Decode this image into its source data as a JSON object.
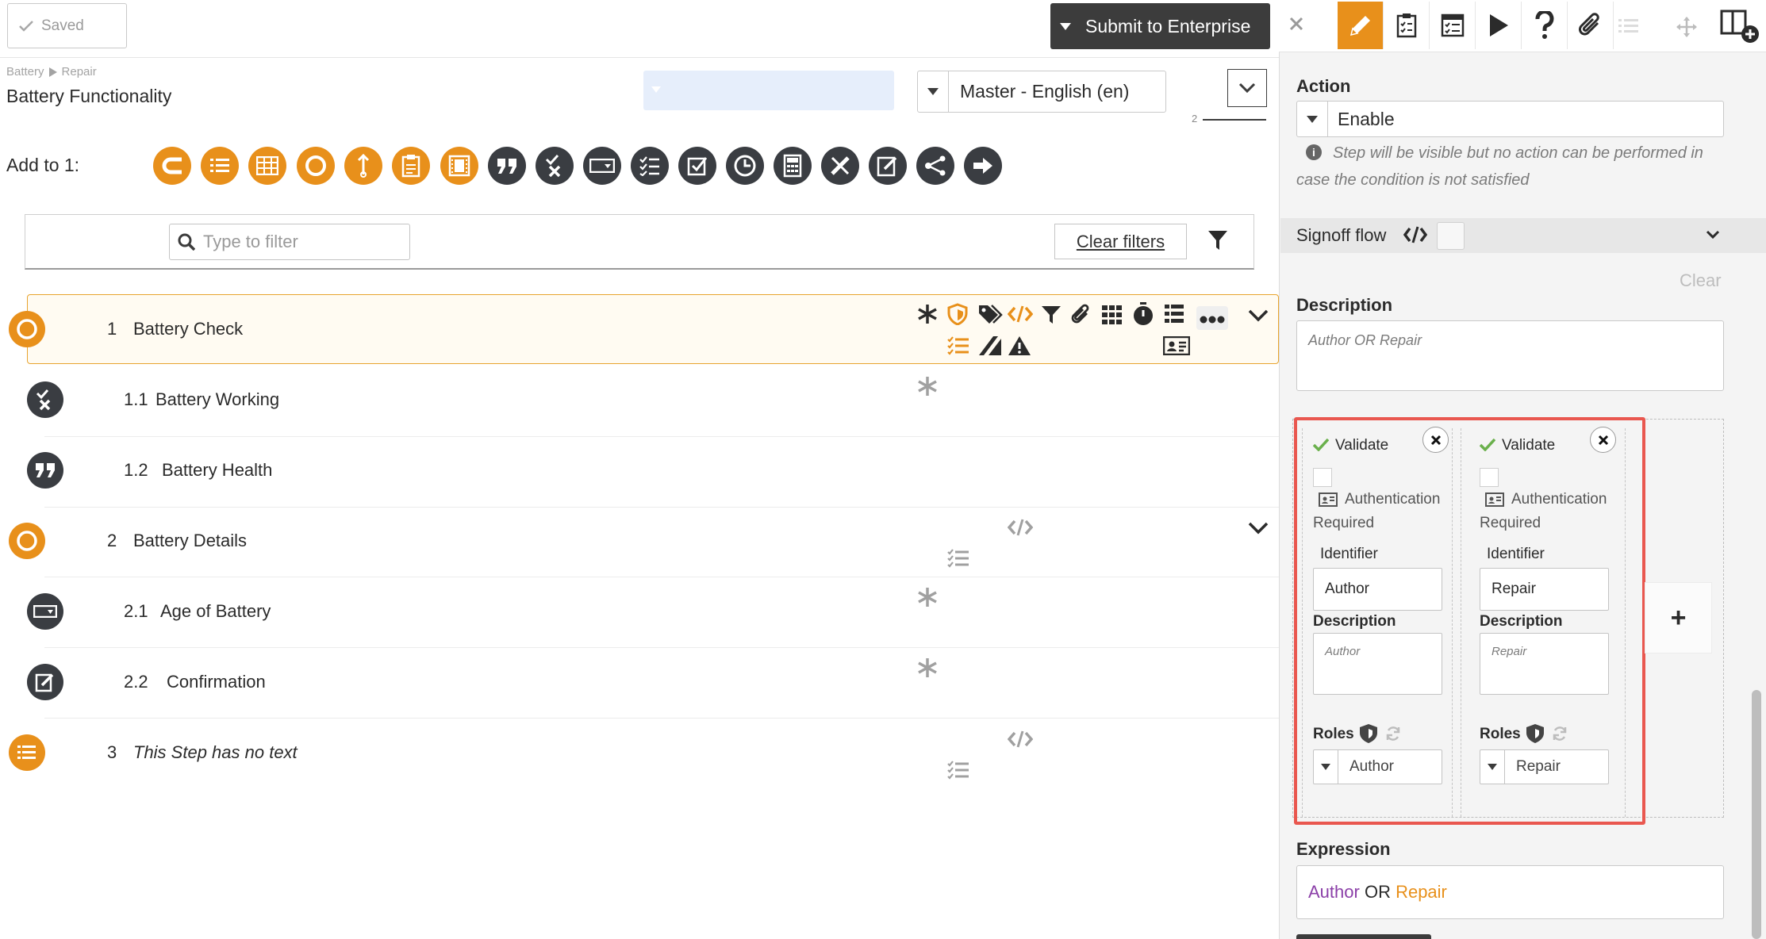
{
  "header": {
    "saved_label": "Saved",
    "submit_label": "Submit to Enterprise"
  },
  "breadcrumb": [
    "Battery",
    "Repair"
  ],
  "page_title": "Battery Functionality",
  "language_select": "Master - English (en)",
  "page_indicator": "2",
  "add_to_label": "Add to 1:",
  "add_to_icons": [
    "loop-icon",
    "list-icon",
    "table-icon",
    "circle-step-icon",
    "wrench-icon",
    "clipboard-icon",
    "film-icon",
    "quote-icon",
    "pass-fail-icon",
    "input-field-icon",
    "checklist-icon",
    "checkbox-icon",
    "clock-icon",
    "calculator-icon",
    "measure-icon",
    "signature-icon",
    "branch-icon",
    "arrow-right-icon"
  ],
  "filter": {
    "placeholder": "Type to filter",
    "clear_label": "Clear filters"
  },
  "steps": [
    {
      "num": "1",
      "text": "Battery Check"
    },
    {
      "num": "1.1",
      "text": "Battery Working"
    },
    {
      "num": "1.2",
      "text": "Battery Health"
    },
    {
      "num": "2",
      "text": "Battery Details"
    },
    {
      "num": "2.1",
      "text": "Age of Battery"
    },
    {
      "num": "2.2",
      "text": "Confirmation"
    },
    {
      "num": "3",
      "text": "This Step has no text"
    }
  ],
  "right_panel": {
    "tools": [
      "pencil-icon",
      "clipboard-check-icon",
      "checklist-board-icon",
      "play-icon",
      "question-icon",
      "paperclip-icon",
      "list-disabled-icon",
      "move-icon",
      "add-panel-icon"
    ],
    "action_label": "Action",
    "action_value": "Enable",
    "action_hint": "Step will be visible but no action can be performed in case the condition is not satisfied",
    "signoff_label": "Signoff flow",
    "clear_label": "Clear",
    "description_label": "Description",
    "description_value": "Author OR Repair",
    "signers": [
      {
        "validate": "Validate",
        "auth": "Authentication Required",
        "identifier_label": "Identifier",
        "identifier": "Author",
        "description_label": "Description",
        "description": "Author",
        "roles_label": "Roles",
        "role": "Author"
      },
      {
        "validate": "Validate",
        "auth": "Authentication Required",
        "identifier_label": "Identifier",
        "identifier": "Repair",
        "description_label": "Description",
        "description": "Repair",
        "roles_label": "Roles",
        "role": "Repair"
      }
    ],
    "add_signer": "+",
    "expression_label": "Expression",
    "expression": {
      "left": "Author",
      "op": "OR",
      "right": "Repair"
    }
  },
  "colors": {
    "accent": "#e8901b",
    "dark": "#3a3d42",
    "highlight": "#e9574f",
    "author": "#8b3fa8"
  }
}
